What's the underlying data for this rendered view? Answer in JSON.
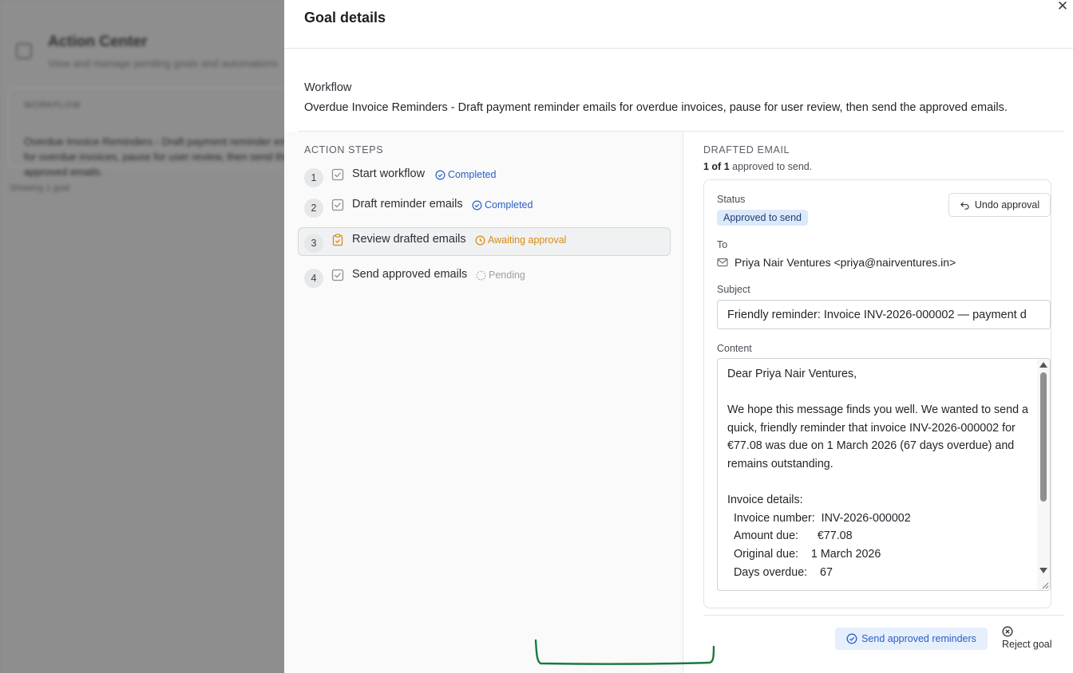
{
  "background": {
    "title": "Action Center",
    "subtitle": "View and manage pending goals and automations",
    "section_label": "WORKFLOW",
    "section_text": "Overdue Invoice Reminders - Draft payment reminder emails for overdue invoices, pause for user review, then send the approved emails.",
    "footer": "Showing 1 goal"
  },
  "panel": {
    "title": "Goal details",
    "workflow_label": "Workflow",
    "workflow_text": "Overdue Invoice Reminders - Draft payment reminder emails for overdue invoices, pause for user review, then send the approved emails."
  },
  "steps": {
    "label": "ACTION STEPS",
    "items": [
      {
        "num": "1",
        "title": "Start workflow",
        "status": "Completed"
      },
      {
        "num": "2",
        "title": "Draft reminder emails",
        "status": "Completed"
      },
      {
        "num": "3",
        "title": "Review drafted emails",
        "status": "Awaiting approval"
      },
      {
        "num": "4",
        "title": "Send approved emails",
        "status": "Pending"
      }
    ]
  },
  "email": {
    "section_label": "DRAFTED EMAIL",
    "count_strong": "1 of 1",
    "count_rest": " approved to send.",
    "status_label": "Status",
    "status_value": "Approved to send",
    "undo_label": "Undo approval",
    "to_label": "To",
    "to_value": "Priya Nair Ventures <priya@nairventures.in>",
    "subject_label": "Subject",
    "subject_value": "Friendly reminder: Invoice INV-2026-000002 — payment d",
    "content_label": "Content",
    "content_text": "Dear Priya Nair Ventures,\n\nWe hope this message finds you well. We wanted to send a quick, friendly reminder that invoice INV-2026-000002 for €77.08 was due on 1 March 2026 (67 days overdue) and remains outstanding.\n\nInvoice details:\n  Invoice number:  INV-2026-000002\n  Amount due:      €77.08\n  Original due:    1 March 2026\n  Days overdue:    67"
  },
  "actions": {
    "send_label": "Send approved reminders",
    "reject_label": "Reject goal"
  },
  "colors": {
    "accent": "#2a5fc4",
    "awaiting": "#d98a13",
    "badge_bg": "#dce9fb",
    "annotation": "#1a7a3a"
  }
}
